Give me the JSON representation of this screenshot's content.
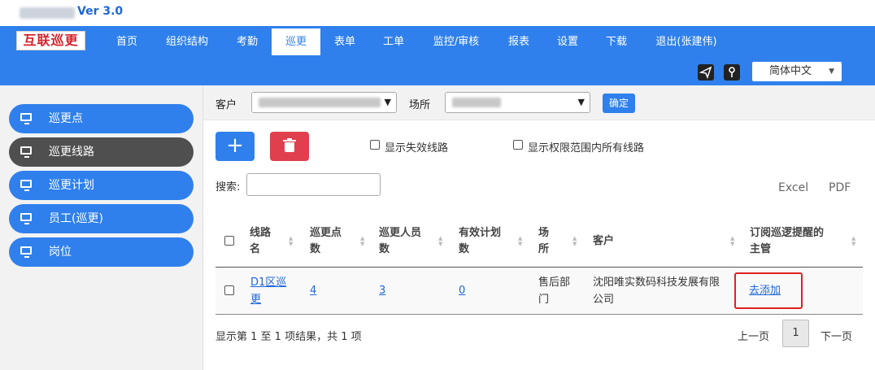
{
  "app": {
    "version": "Ver 3.0",
    "logo_text": "互联巡更"
  },
  "nav": {
    "items": [
      "首页",
      "组织结构",
      "考勤",
      "巡更",
      "表单",
      "工单",
      "监控/审核",
      "报表",
      "设置",
      "下载",
      "退出(张建伟)"
    ],
    "active": "巡更"
  },
  "toolbar": {
    "language": "简体中文"
  },
  "sidebar": {
    "items": [
      {
        "label": "巡更点",
        "icon": "monitor-icon"
      },
      {
        "label": "巡更线路",
        "icon": "monitor-icon"
      },
      {
        "label": "巡更计划",
        "icon": "monitor-icon"
      },
      {
        "label": "员工(巡更)",
        "icon": "monitor-icon"
      },
      {
        "label": "岗位",
        "icon": "monitor-icon"
      }
    ],
    "active": "巡更线路"
  },
  "filters": {
    "customer_label": "客户",
    "site_label": "场所",
    "confirm_label": "确定"
  },
  "actions": {
    "add_symbol": "+",
    "show_invalid": "显示失效线路",
    "show_all_in_scope": "显示权限范围内所有线路"
  },
  "search": {
    "label": "搜索:",
    "value": ""
  },
  "export": {
    "excel": "Excel",
    "pdf": "PDF"
  },
  "table": {
    "headers": {
      "route_line1": "线路",
      "route_line2": "名",
      "points_line1": "巡更点",
      "points_line2": "数",
      "staff_line1": "巡更人员",
      "staff_line2": "数",
      "plans_line1": "有效计划",
      "plans_line2": "数",
      "site_line1": "场",
      "site_line2": "所",
      "customer": "客户",
      "sub_line1": "订阅巡逻提醒的",
      "sub_line2": "主管"
    },
    "rows": [
      {
        "route_line1": "D1区巡",
        "route_line2": "更",
        "points": "4",
        "staff": "3",
        "plans": "0",
        "site_line1": "售后部",
        "site_line2": "门",
        "customer_line1": "沈阳唯实数码科技发展有限",
        "customer_line2": "公司",
        "subscribe": "去添加"
      }
    ]
  },
  "footer": {
    "info": "显示第 1 至 1 项结果，共 1 项",
    "prev": "上一页",
    "page": "1",
    "next": "下一页"
  },
  "colors": {
    "primary": "#2f80ec",
    "danger": "#e0404d",
    "sidebar_active": "#4f4f4f",
    "highlight": "#e02020"
  }
}
